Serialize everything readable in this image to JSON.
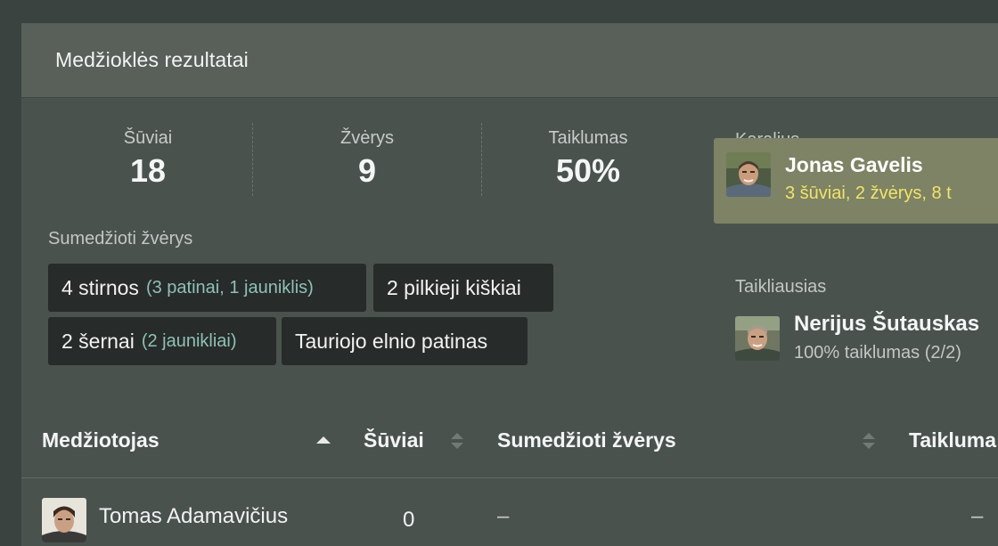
{
  "panel": {
    "title": "Medžioklės rezultatai"
  },
  "stats": [
    {
      "label": "Šūviai",
      "value": "18"
    },
    {
      "label": "Žvėrys",
      "value": "9"
    },
    {
      "label": "Taiklumas",
      "value": "50%"
    }
  ],
  "hunted": {
    "label": "Sumedžioti žvėrys",
    "chips": [
      {
        "main": "4 stirnos",
        "detail": "(3 patinai, 1 jauniklis)"
      },
      {
        "main": "2 pilkieji kiškiai",
        "detail": ""
      },
      {
        "main": "2 šernai",
        "detail": "(2 jaunikliai)"
      },
      {
        "main": "Tauriojo elnio patinas",
        "detail": ""
      }
    ]
  },
  "king": {
    "label": "Karalius",
    "name": "Jonas Gavelis",
    "stats": "3 šūviai, 2 žvėrys, 8 t"
  },
  "most_accurate": {
    "label": "Taikliausias",
    "name": "Nerijus Šutauskas",
    "stats": "100% taiklumas (2/2)"
  },
  "table": {
    "columns": [
      "Medžiotojas",
      "Šūviai",
      "Sumedžioti žvėrys",
      "Taikluma"
    ],
    "rows": [
      {
        "hunter": "Tomas Adamavičius",
        "shots": "0",
        "hunted": "–",
        "accuracy": "–"
      }
    ]
  },
  "colors": {
    "background": "#3a433f",
    "panel": "#4a524e",
    "header": "#586059",
    "chip": "#272b29",
    "chip_detail": "#8fc1b4",
    "king_box": "#7d8364",
    "king_stats": "#f2e36a"
  }
}
